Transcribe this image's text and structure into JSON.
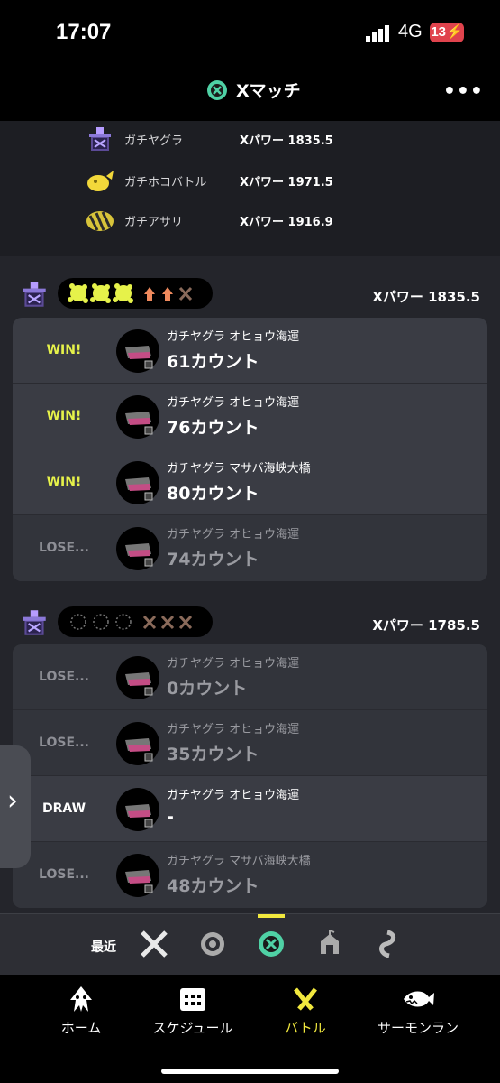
{
  "status_bar": {
    "time": "17:07",
    "network": "4G",
    "battery": "13"
  },
  "header": {
    "title": "Xマッチ",
    "more_icon": "ellipsis-icon"
  },
  "modes": [
    {
      "name": "ガチヤグラ",
      "power": "Xパワー 1835.5",
      "icon": "tower-icon"
    },
    {
      "name": "ガチホコバトル",
      "power": "Xパワー 1971.5",
      "icon": "rainmaker-icon"
    },
    {
      "name": "ガチアサリ",
      "power": "Xパワー 1916.9",
      "icon": "clam-icon"
    }
  ],
  "sets": [
    {
      "power": "Xパワー 1835.5",
      "wins": 3,
      "losses_marked": 1,
      "matches": [
        {
          "result": "WIN!",
          "stage": "ガチヤグラ オヒョウ海運",
          "count": "61カウント"
        },
        {
          "result": "WIN!",
          "stage": "ガチヤグラ オヒョウ海運",
          "count": "76カウント"
        },
        {
          "result": "WIN!",
          "stage": "ガチヤグラ マサバ海峡大橋",
          "count": "80カウント"
        },
        {
          "result": "LOSE...",
          "stage": "ガチヤグラ オヒョウ海運",
          "count": "74カウント"
        }
      ]
    },
    {
      "power": "Xパワー 1785.5",
      "wins": 0,
      "losses_marked": 3,
      "matches": [
        {
          "result": "LOSE...",
          "stage": "ガチヤグラ オヒョウ海運",
          "count": "0カウント"
        },
        {
          "result": "LOSE...",
          "stage": "ガチヤグラ オヒョウ海運",
          "count": "35カウント"
        },
        {
          "result": "DRAW",
          "stage": "ガチヤグラ オヒョウ海運",
          "count": "-"
        },
        {
          "result": "LOSE...",
          "stage": "ガチヤグラ マサバ海峡大橋",
          "count": "48カウント"
        }
      ]
    }
  ],
  "mode_tabs": {
    "recent_label": "最近",
    "icons": [
      "regular-battle-icon",
      "anarchy-battle-icon",
      "x-battle-icon",
      "challenge-icon",
      "private-battle-icon"
    ]
  },
  "nav": [
    {
      "label": "ホーム",
      "icon": "squid-icon"
    },
    {
      "label": "スケジュール",
      "icon": "calendar-icon"
    },
    {
      "label": "バトル",
      "icon": "battle-icon",
      "active": true
    },
    {
      "label": "サーモンラン",
      "icon": "salmon-icon"
    }
  ],
  "colors": {
    "accent": "#f1e83e",
    "win": "#e6f24a",
    "lose": "#8e8f96",
    "x_mode": "#4fd1a5"
  }
}
